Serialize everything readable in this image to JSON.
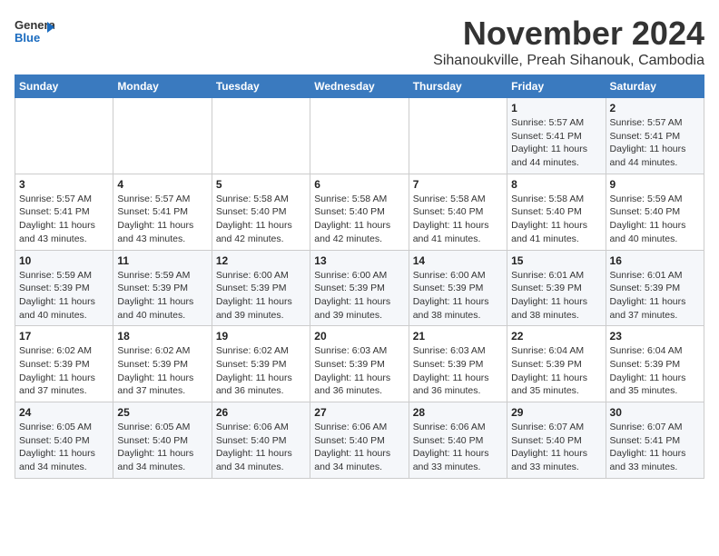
{
  "header": {
    "logo_line1": "General",
    "logo_line2": "Blue",
    "month": "November 2024",
    "location": "Sihanoukville, Preah Sihanouk, Cambodia"
  },
  "weekdays": [
    "Sunday",
    "Monday",
    "Tuesday",
    "Wednesday",
    "Thursday",
    "Friday",
    "Saturday"
  ],
  "weeks": [
    [
      {
        "day": "",
        "info": ""
      },
      {
        "day": "",
        "info": ""
      },
      {
        "day": "",
        "info": ""
      },
      {
        "day": "",
        "info": ""
      },
      {
        "day": "",
        "info": ""
      },
      {
        "day": "1",
        "info": "Sunrise: 5:57 AM\nSunset: 5:41 PM\nDaylight: 11 hours\nand 44 minutes."
      },
      {
        "day": "2",
        "info": "Sunrise: 5:57 AM\nSunset: 5:41 PM\nDaylight: 11 hours\nand 44 minutes."
      }
    ],
    [
      {
        "day": "3",
        "info": "Sunrise: 5:57 AM\nSunset: 5:41 PM\nDaylight: 11 hours\nand 43 minutes."
      },
      {
        "day": "4",
        "info": "Sunrise: 5:57 AM\nSunset: 5:41 PM\nDaylight: 11 hours\nand 43 minutes."
      },
      {
        "day": "5",
        "info": "Sunrise: 5:58 AM\nSunset: 5:40 PM\nDaylight: 11 hours\nand 42 minutes."
      },
      {
        "day": "6",
        "info": "Sunrise: 5:58 AM\nSunset: 5:40 PM\nDaylight: 11 hours\nand 42 minutes."
      },
      {
        "day": "7",
        "info": "Sunrise: 5:58 AM\nSunset: 5:40 PM\nDaylight: 11 hours\nand 41 minutes."
      },
      {
        "day": "8",
        "info": "Sunrise: 5:58 AM\nSunset: 5:40 PM\nDaylight: 11 hours\nand 41 minutes."
      },
      {
        "day": "9",
        "info": "Sunrise: 5:59 AM\nSunset: 5:40 PM\nDaylight: 11 hours\nand 40 minutes."
      }
    ],
    [
      {
        "day": "10",
        "info": "Sunrise: 5:59 AM\nSunset: 5:39 PM\nDaylight: 11 hours\nand 40 minutes."
      },
      {
        "day": "11",
        "info": "Sunrise: 5:59 AM\nSunset: 5:39 PM\nDaylight: 11 hours\nand 40 minutes."
      },
      {
        "day": "12",
        "info": "Sunrise: 6:00 AM\nSunset: 5:39 PM\nDaylight: 11 hours\nand 39 minutes."
      },
      {
        "day": "13",
        "info": "Sunrise: 6:00 AM\nSunset: 5:39 PM\nDaylight: 11 hours\nand 39 minutes."
      },
      {
        "day": "14",
        "info": "Sunrise: 6:00 AM\nSunset: 5:39 PM\nDaylight: 11 hours\nand 38 minutes."
      },
      {
        "day": "15",
        "info": "Sunrise: 6:01 AM\nSunset: 5:39 PM\nDaylight: 11 hours\nand 38 minutes."
      },
      {
        "day": "16",
        "info": "Sunrise: 6:01 AM\nSunset: 5:39 PM\nDaylight: 11 hours\nand 37 minutes."
      }
    ],
    [
      {
        "day": "17",
        "info": "Sunrise: 6:02 AM\nSunset: 5:39 PM\nDaylight: 11 hours\nand 37 minutes."
      },
      {
        "day": "18",
        "info": "Sunrise: 6:02 AM\nSunset: 5:39 PM\nDaylight: 11 hours\nand 37 minutes."
      },
      {
        "day": "19",
        "info": "Sunrise: 6:02 AM\nSunset: 5:39 PM\nDaylight: 11 hours\nand 36 minutes."
      },
      {
        "day": "20",
        "info": "Sunrise: 6:03 AM\nSunset: 5:39 PM\nDaylight: 11 hours\nand 36 minutes."
      },
      {
        "day": "21",
        "info": "Sunrise: 6:03 AM\nSunset: 5:39 PM\nDaylight: 11 hours\nand 36 minutes."
      },
      {
        "day": "22",
        "info": "Sunrise: 6:04 AM\nSunset: 5:39 PM\nDaylight: 11 hours\nand 35 minutes."
      },
      {
        "day": "23",
        "info": "Sunrise: 6:04 AM\nSunset: 5:39 PM\nDaylight: 11 hours\nand 35 minutes."
      }
    ],
    [
      {
        "day": "24",
        "info": "Sunrise: 6:05 AM\nSunset: 5:40 PM\nDaylight: 11 hours\nand 34 minutes."
      },
      {
        "day": "25",
        "info": "Sunrise: 6:05 AM\nSunset: 5:40 PM\nDaylight: 11 hours\nand 34 minutes."
      },
      {
        "day": "26",
        "info": "Sunrise: 6:06 AM\nSunset: 5:40 PM\nDaylight: 11 hours\nand 34 minutes."
      },
      {
        "day": "27",
        "info": "Sunrise: 6:06 AM\nSunset: 5:40 PM\nDaylight: 11 hours\nand 34 minutes."
      },
      {
        "day": "28",
        "info": "Sunrise: 6:06 AM\nSunset: 5:40 PM\nDaylight: 11 hours\nand 33 minutes."
      },
      {
        "day": "29",
        "info": "Sunrise: 6:07 AM\nSunset: 5:40 PM\nDaylight: 11 hours\nand 33 minutes."
      },
      {
        "day": "30",
        "info": "Sunrise: 6:07 AM\nSunset: 5:41 PM\nDaylight: 11 hours\nand 33 minutes."
      }
    ]
  ]
}
